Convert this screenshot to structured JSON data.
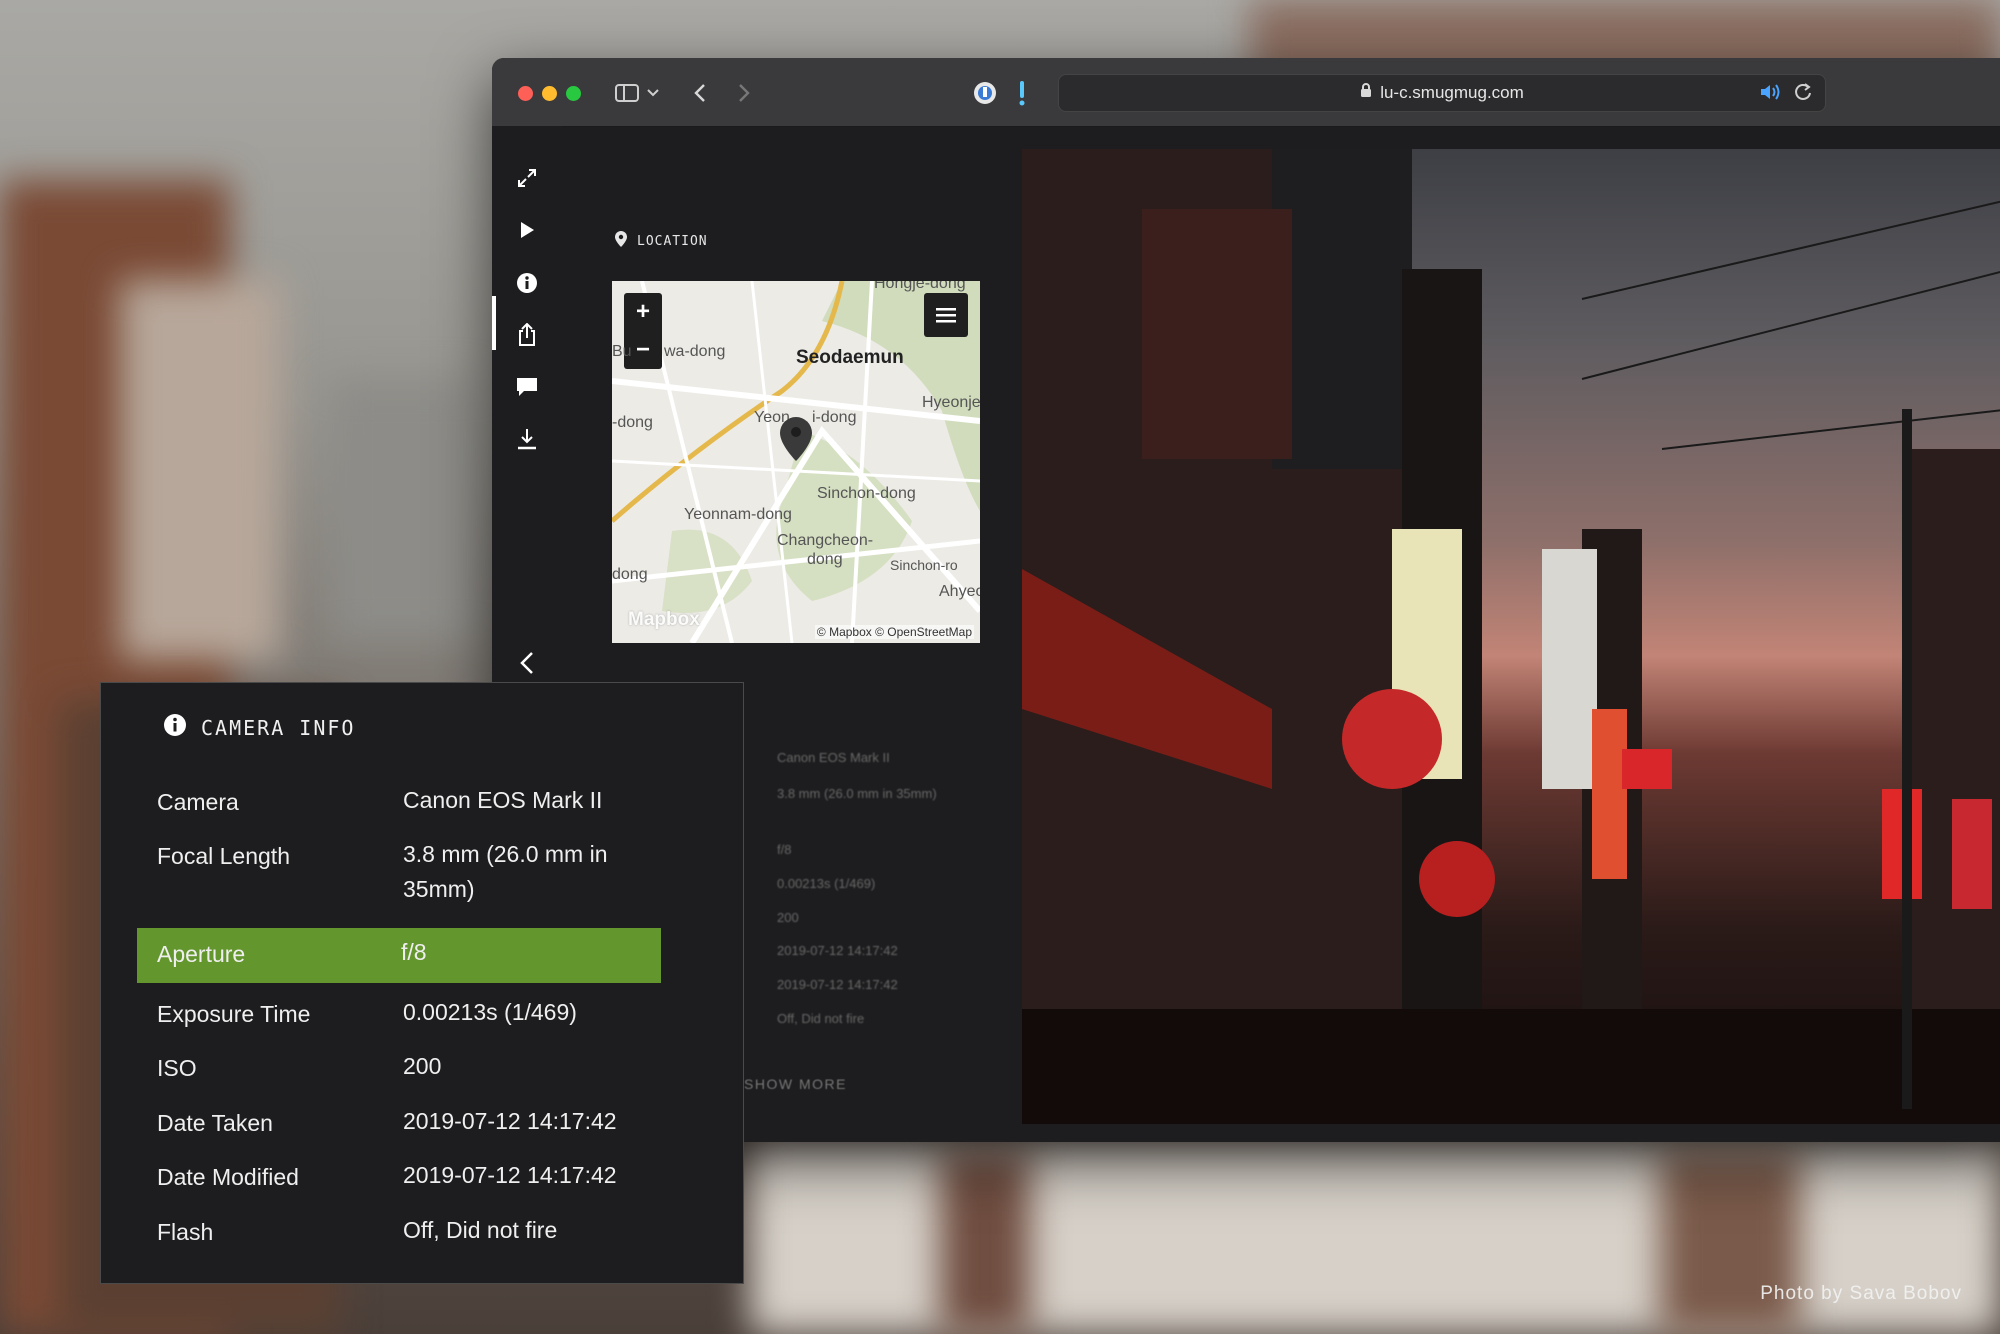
{
  "browser": {
    "url": "lu-c.smugmug.com"
  },
  "location": {
    "label": "LOCATION"
  },
  "map": {
    "zoom_in": "+",
    "zoom_out": "−",
    "labels": [
      "Seodaemun",
      "Hongje-dong",
      "Bu",
      "wa-dong",
      "-dong",
      "Yeon",
      "i-dong",
      "Hyeonje",
      "Sinchon-dong",
      "Yeonnam-dong",
      "Changcheon-",
      "dong",
      "Sinchon-ro",
      "dong",
      "Ahyeo"
    ],
    "logo": "Mapbox",
    "attribution": "© Mapbox © OpenStreetMap"
  },
  "background_panel": {
    "values": [
      "Canon EOS Mark II",
      "3.8 mm (26.0 mm in 35mm)",
      "f/8",
      "0.00213s (1/469)",
      "200",
      "2019-07-12 14:17:42",
      "2019-07-12 14:17:42",
      "Off, Did not fire"
    ],
    "show_more": "SHOW MORE"
  },
  "camera_info": {
    "title": "CAMERA INFO",
    "rows": [
      {
        "label": "Camera",
        "value": "Canon EOS Mark II"
      },
      {
        "label": "Focal Length",
        "value": "3.8 mm (26.0 mm in 35mm)"
      },
      {
        "label": "Aperture",
        "value": "f/8",
        "highlighted": true
      },
      {
        "label": "Exposure Time",
        "value": "0.00213s (1/469)"
      },
      {
        "label": "ISO",
        "value": "200"
      },
      {
        "label": "Date Taken",
        "value": "2019-07-12 14:17:42"
      },
      {
        "label": "Date Modified",
        "value": "2019-07-12 14:17:42"
      },
      {
        "label": "Flash",
        "value": "Off, Did not fire"
      }
    ],
    "highlight_color": "#64962e"
  },
  "photo_credit": "Photo by Sava Bobov",
  "icons": {
    "sidebar": [
      "fullscreen-icon",
      "play-icon",
      "info-icon",
      "share-icon",
      "comment-icon",
      "download-icon",
      "back-chevron-icon"
    ],
    "toolbar": [
      "sidebar-toggle-icon",
      "chevron-down-icon",
      "back-icon",
      "forward-icon",
      "password-icon",
      "alert-icon",
      "lock-icon",
      "speaker-icon",
      "reload-icon"
    ]
  }
}
